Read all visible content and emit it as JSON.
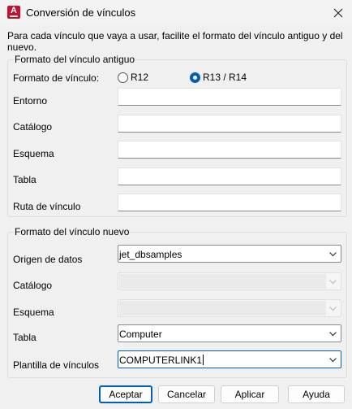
{
  "window": {
    "title": "Conversión de vínculos",
    "app_icon_letter": "A"
  },
  "intro": "Para cada vínculo que vaya a usar, facilite el formato del vínculo antiguo y del nuevo.",
  "old_format": {
    "group_label": "Formato del vínculo antiguo",
    "link_format_label": "Formato de vínculo:",
    "radio_r12": {
      "label": "R12",
      "checked": false
    },
    "radio_r13": {
      "label": "R13 / R14",
      "checked": true
    },
    "fields": [
      {
        "label": "Entorno",
        "value": ""
      },
      {
        "label": "Catálogo",
        "value": ""
      },
      {
        "label": "Esquema",
        "value": ""
      },
      {
        "label": "Tabla",
        "value": ""
      },
      {
        "label": "Ruta de vínculo",
        "value": ""
      }
    ]
  },
  "new_format": {
    "group_label": "Formato del vínculo nuevo",
    "data_source": {
      "label": "Origen de datos",
      "value": "jet_dbsamples"
    },
    "catalog": {
      "label": "Catálogo",
      "value": "",
      "disabled": true
    },
    "schema": {
      "label": "Esquema",
      "value": "",
      "disabled": true
    },
    "table": {
      "label": "Tabla",
      "value": "Computer"
    },
    "link_template": {
      "label": "Plantilla de vínculos",
      "value": "COMPUTERLINK1"
    }
  },
  "buttons": {
    "accept": "Aceptar",
    "cancel": "Cancelar",
    "apply": "Aplicar",
    "help": "Ayuda"
  },
  "colors": {
    "accent": "#005fb8",
    "app_icon": "#c8102e"
  }
}
